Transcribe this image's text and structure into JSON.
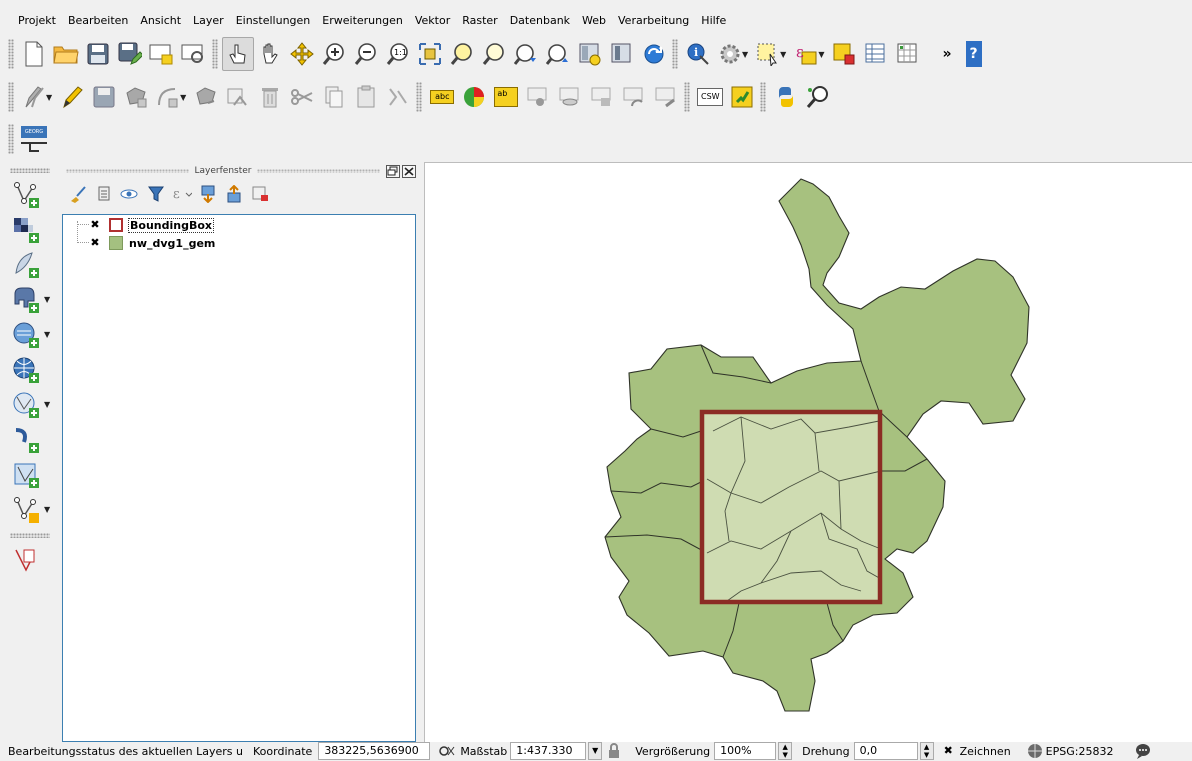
{
  "menu": [
    "Projekt",
    "Bearbeiten",
    "Ansicht",
    "Layer",
    "Einstellungen",
    "Erweiterungen",
    "Vektor",
    "Raster",
    "Datenbank",
    "Web",
    "Verarbeitung",
    "Hilfe"
  ],
  "toolbar": {
    "overflow_label": "»",
    "help_label": "?",
    "label_csw": "CSW",
    "label_abc": "abc",
    "label_ab": "ab",
    "georef_label": "GEORG"
  },
  "layer_panel": {
    "title": "Layerfenster",
    "layers": [
      {
        "name": "BoundingBox",
        "visible": true,
        "symbol": "outline-box",
        "color": "#b03030"
      },
      {
        "name": "nw_dvg1_gem",
        "visible": true,
        "symbol": "filled-box",
        "color": "#a4c080"
      }
    ]
  },
  "statusbar": {
    "edit_status": "Bearbeitungsstatus des aktuellen Layers u",
    "coord_label": "Koordinate",
    "coord_value": "383225,5636900",
    "scale_label": "Maßstab",
    "scale_value": "1:437.330",
    "magnifier_label": "Vergrößerung",
    "magnifier_value": "100%",
    "rotation_label": "Drehung",
    "rotation_value": "0,0",
    "render_label": "Zeichnen",
    "crs_label": "EPSG:25832"
  },
  "colors": {
    "polygon_fill": "#a7c17f",
    "polygon_fill_inside": "#cfdcb2",
    "polygon_stroke": "#2f3328",
    "bbox_stroke": "#8b2c24",
    "selection_blue": "#3c7fb1"
  }
}
